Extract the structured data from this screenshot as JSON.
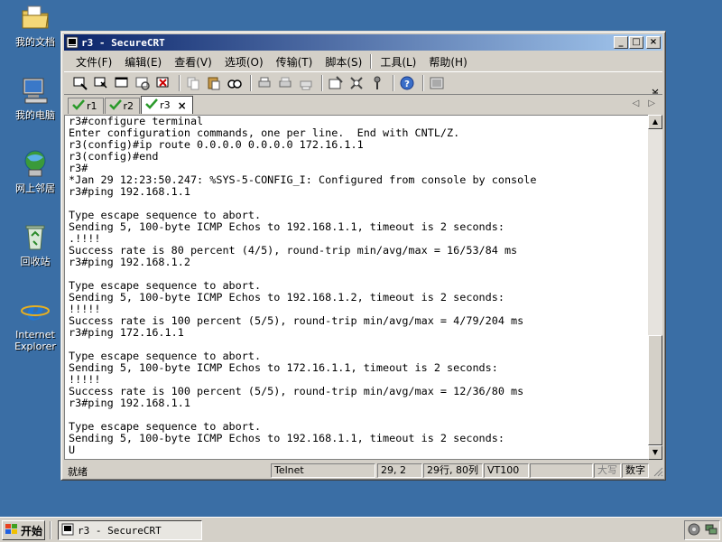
{
  "desktop": {
    "icons": [
      {
        "label": "我的文档",
        "icon": "folder-documents-icon"
      },
      {
        "label": "我的电脑",
        "icon": "computer-icon"
      },
      {
        "label": "网上邻居",
        "icon": "network-icon"
      },
      {
        "label": "回收站",
        "icon": "recycle-bin-icon"
      },
      {
        "label": "Internet Explorer",
        "icon": "internet-explorer-icon"
      }
    ]
  },
  "window": {
    "title": "r3 - SecureCRT",
    "controls": {
      "minimize": "_",
      "maximize": "□",
      "close": "×"
    }
  },
  "menu": {
    "items": [
      "文件(F)",
      "编辑(E)",
      "查看(V)",
      "选项(O)",
      "传输(T)",
      "脚本(S)",
      "工具(L)",
      "帮助(H)"
    ]
  },
  "tabs": [
    {
      "label": "r1",
      "active": false
    },
    {
      "label": "r2",
      "active": false
    },
    {
      "label": "r3",
      "active": true
    }
  ],
  "tab_close": "×",
  "terminal": {
    "lines": [
      "r3#configure terminal",
      "Enter configuration commands, one per line.  End with CNTL/Z.",
      "r3(config)#ip route 0.0.0.0 0.0.0.0 172.16.1.1",
      "r3(config)#end",
      "r3#",
      "*Jan 29 12:23:50.247: %SYS-5-CONFIG_I: Configured from console by console",
      "r3#ping 192.168.1.1",
      "",
      "Type escape sequence to abort.",
      "Sending 5, 100-byte ICMP Echos to 192.168.1.1, timeout is 2 seconds:",
      ".!!!!",
      "Success rate is 80 percent (4/5), round-trip min/avg/max = 16/53/84 ms",
      "r3#ping 192.168.1.2",
      "",
      "Type escape sequence to abort.",
      "Sending 5, 100-byte ICMP Echos to 192.168.1.2, timeout is 2 seconds:",
      "!!!!!",
      "Success rate is 100 percent (5/5), round-trip min/avg/max = 4/79/204 ms",
      "r3#ping 172.16.1.1",
      "",
      "Type escape sequence to abort.",
      "Sending 5, 100-byte ICMP Echos to 172.16.1.1, timeout is 2 seconds:",
      "!!!!!",
      "Success rate is 100 percent (5/5), round-trip min/avg/max = 12/36/80 ms",
      "r3#ping 192.168.1.1",
      "",
      "Type escape sequence to abort.",
      "Sending 5, 100-byte ICMP Echos to 192.168.1.1, timeout is 2 seconds:",
      "U"
    ]
  },
  "status": {
    "ready": "就绪",
    "protocol": "Telnet",
    "cursor": "29,  2",
    "size": "29行, 80列",
    "emulation": "VT100",
    "caps": "大写",
    "num": "数字"
  },
  "taskbar": {
    "start_label": "开始",
    "task_label": "r3 - SecureCRT"
  }
}
